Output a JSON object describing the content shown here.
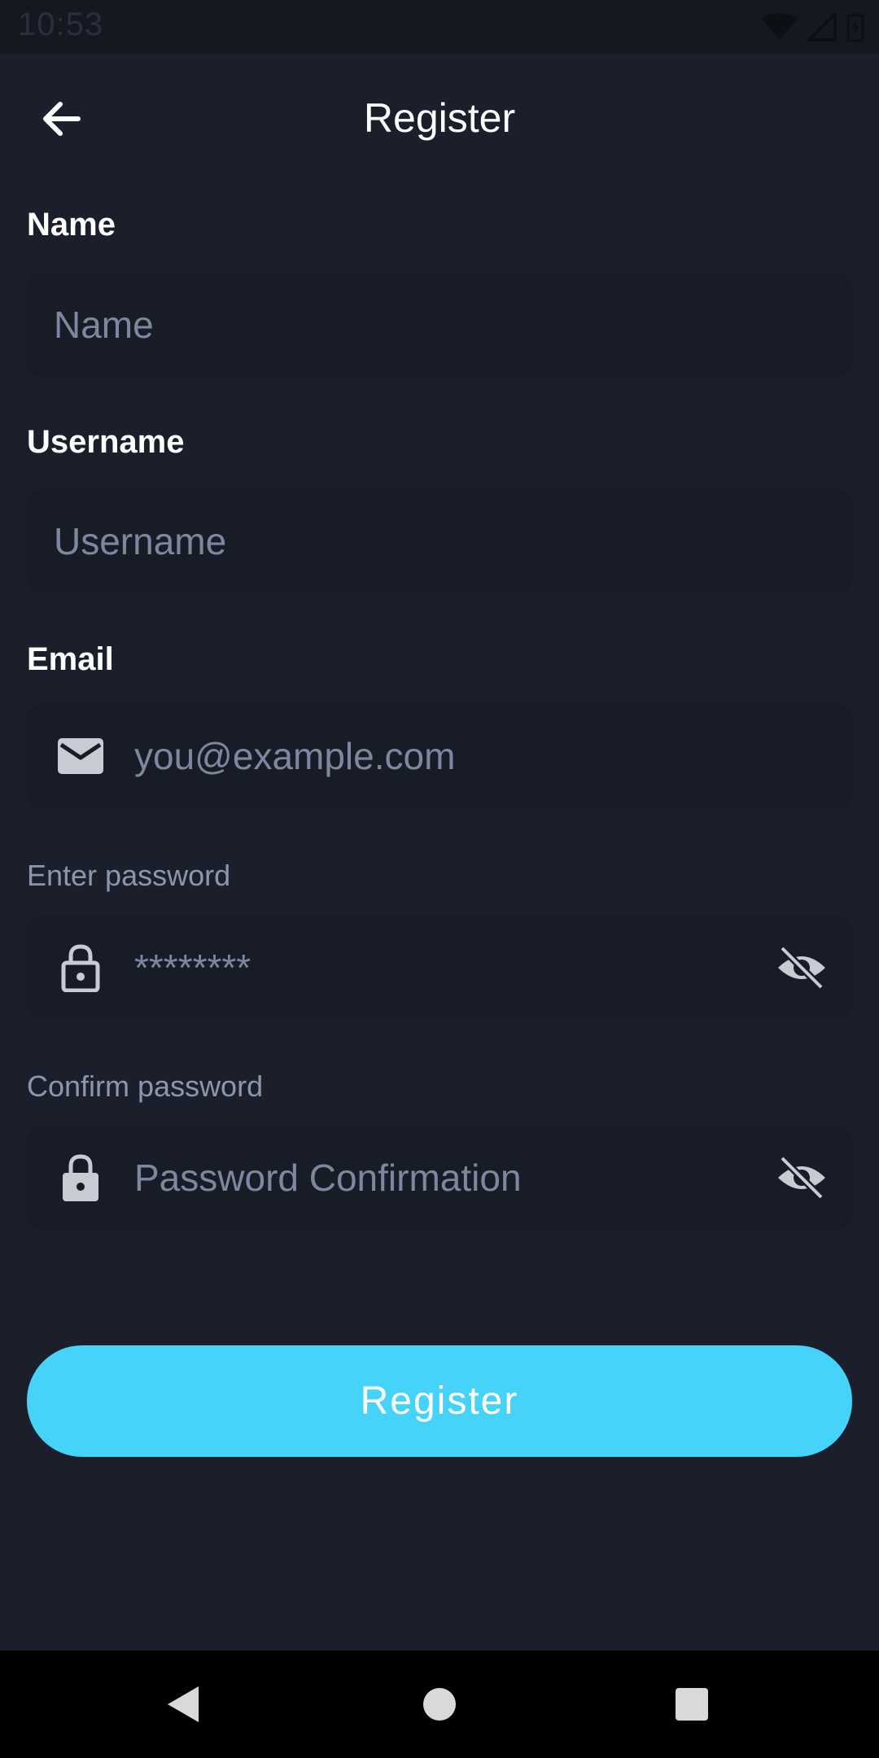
{
  "status_bar": {
    "time": "10:53"
  },
  "header": {
    "title": "Register"
  },
  "form": {
    "name": {
      "label": "Name",
      "placeholder": "Name"
    },
    "username": {
      "label": "Username",
      "placeholder": "Username"
    },
    "email": {
      "label": "Email",
      "placeholder": "you@example.com"
    },
    "password": {
      "label": "Enter password",
      "value": "********"
    },
    "confirm_password": {
      "label": "Confirm password",
      "placeholder": "Password Confirmation"
    }
  },
  "register_button": {
    "label": "Register"
  },
  "colors": {
    "background": "#1b1f2b",
    "field": "#181c27",
    "accent": "#45d3fa",
    "placeholder": "#7d889f"
  }
}
